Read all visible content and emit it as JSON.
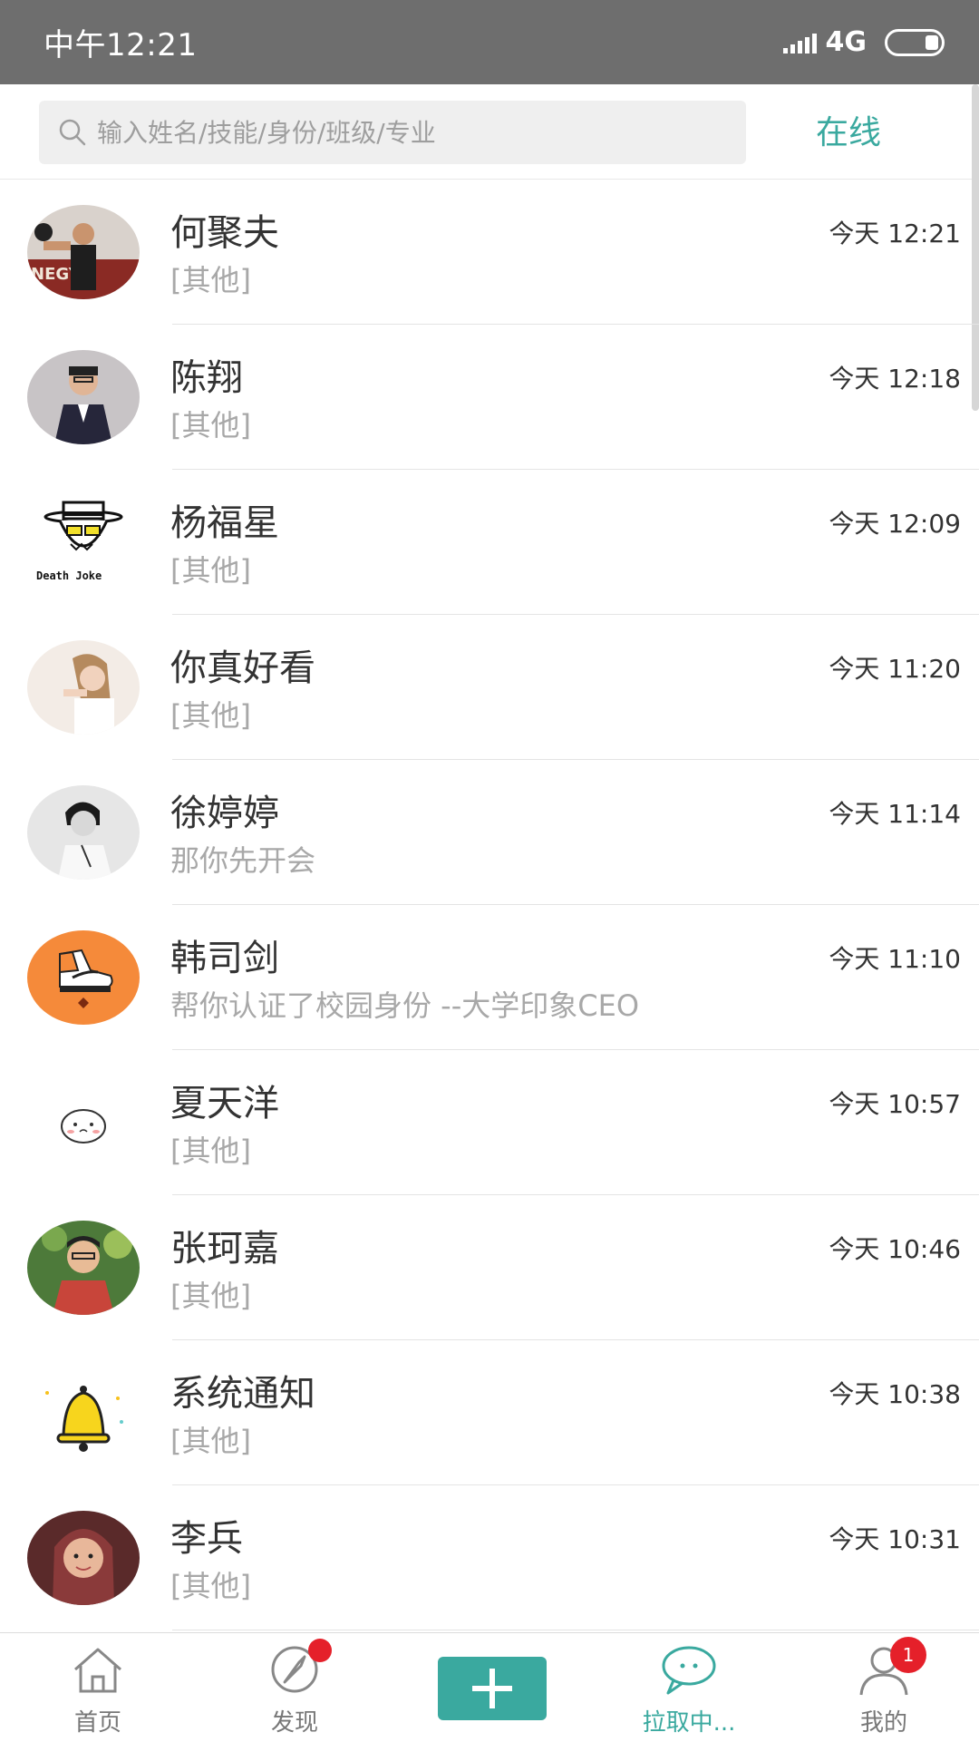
{
  "status_bar": {
    "time": "中午12:21",
    "network": "4G",
    "network_sub": "ıl"
  },
  "search": {
    "placeholder": "输入姓名/技能/身份/班级/专业",
    "online_label": "在线"
  },
  "colors": {
    "accent": "#3aa99f",
    "badge": "#e5202a",
    "status_bar": "#6e6e6e"
  },
  "chats": [
    {
      "name": "何聚夫",
      "preview": "[其他]",
      "time": "今天 12:21",
      "avatar": "boxer-photo"
    },
    {
      "name": "陈翔",
      "preview": "[其他]",
      "time": "今天 12:18",
      "avatar": "suit-photo"
    },
    {
      "name": "杨福星",
      "preview": "[其他]",
      "time": "今天 12:09",
      "avatar": "death-joke-logo",
      "avatar_text": "Death Joke"
    },
    {
      "name": "你真好看",
      "preview": "[其他]",
      "time": "今天 11:20",
      "avatar": "girl-photo"
    },
    {
      "name": "徐婷婷",
      "preview": "那你先开会",
      "time": "今天 11:14",
      "avatar": "bw-portrait"
    },
    {
      "name": "韩司剑",
      "preview": "帮你认证了校园身份 --大学印象CEO",
      "time": "今天 11:10",
      "avatar": "sneaker-logo"
    },
    {
      "name": "夏天洋",
      "preview": "[其他]",
      "time": "今天 10:57",
      "avatar": "cute-face"
    },
    {
      "name": "张珂嘉",
      "preview": "[其他]",
      "time": "今天 10:46",
      "avatar": "man-photo"
    },
    {
      "name": "系统通知",
      "preview": "[其他]",
      "time": "今天 10:38",
      "avatar": "bell-icon"
    },
    {
      "name": "李兵",
      "preview": "[其他]",
      "time": "今天 10:31",
      "avatar": "woman-photo"
    }
  ],
  "tabs": [
    {
      "label": "首页",
      "icon": "home-icon"
    },
    {
      "label": "发现",
      "icon": "compass-icon"
    },
    {
      "label": "拉取中...",
      "icon": "chat-bubble-icon"
    },
    {
      "label": "我的",
      "icon": "person-icon",
      "badge": "1"
    }
  ]
}
